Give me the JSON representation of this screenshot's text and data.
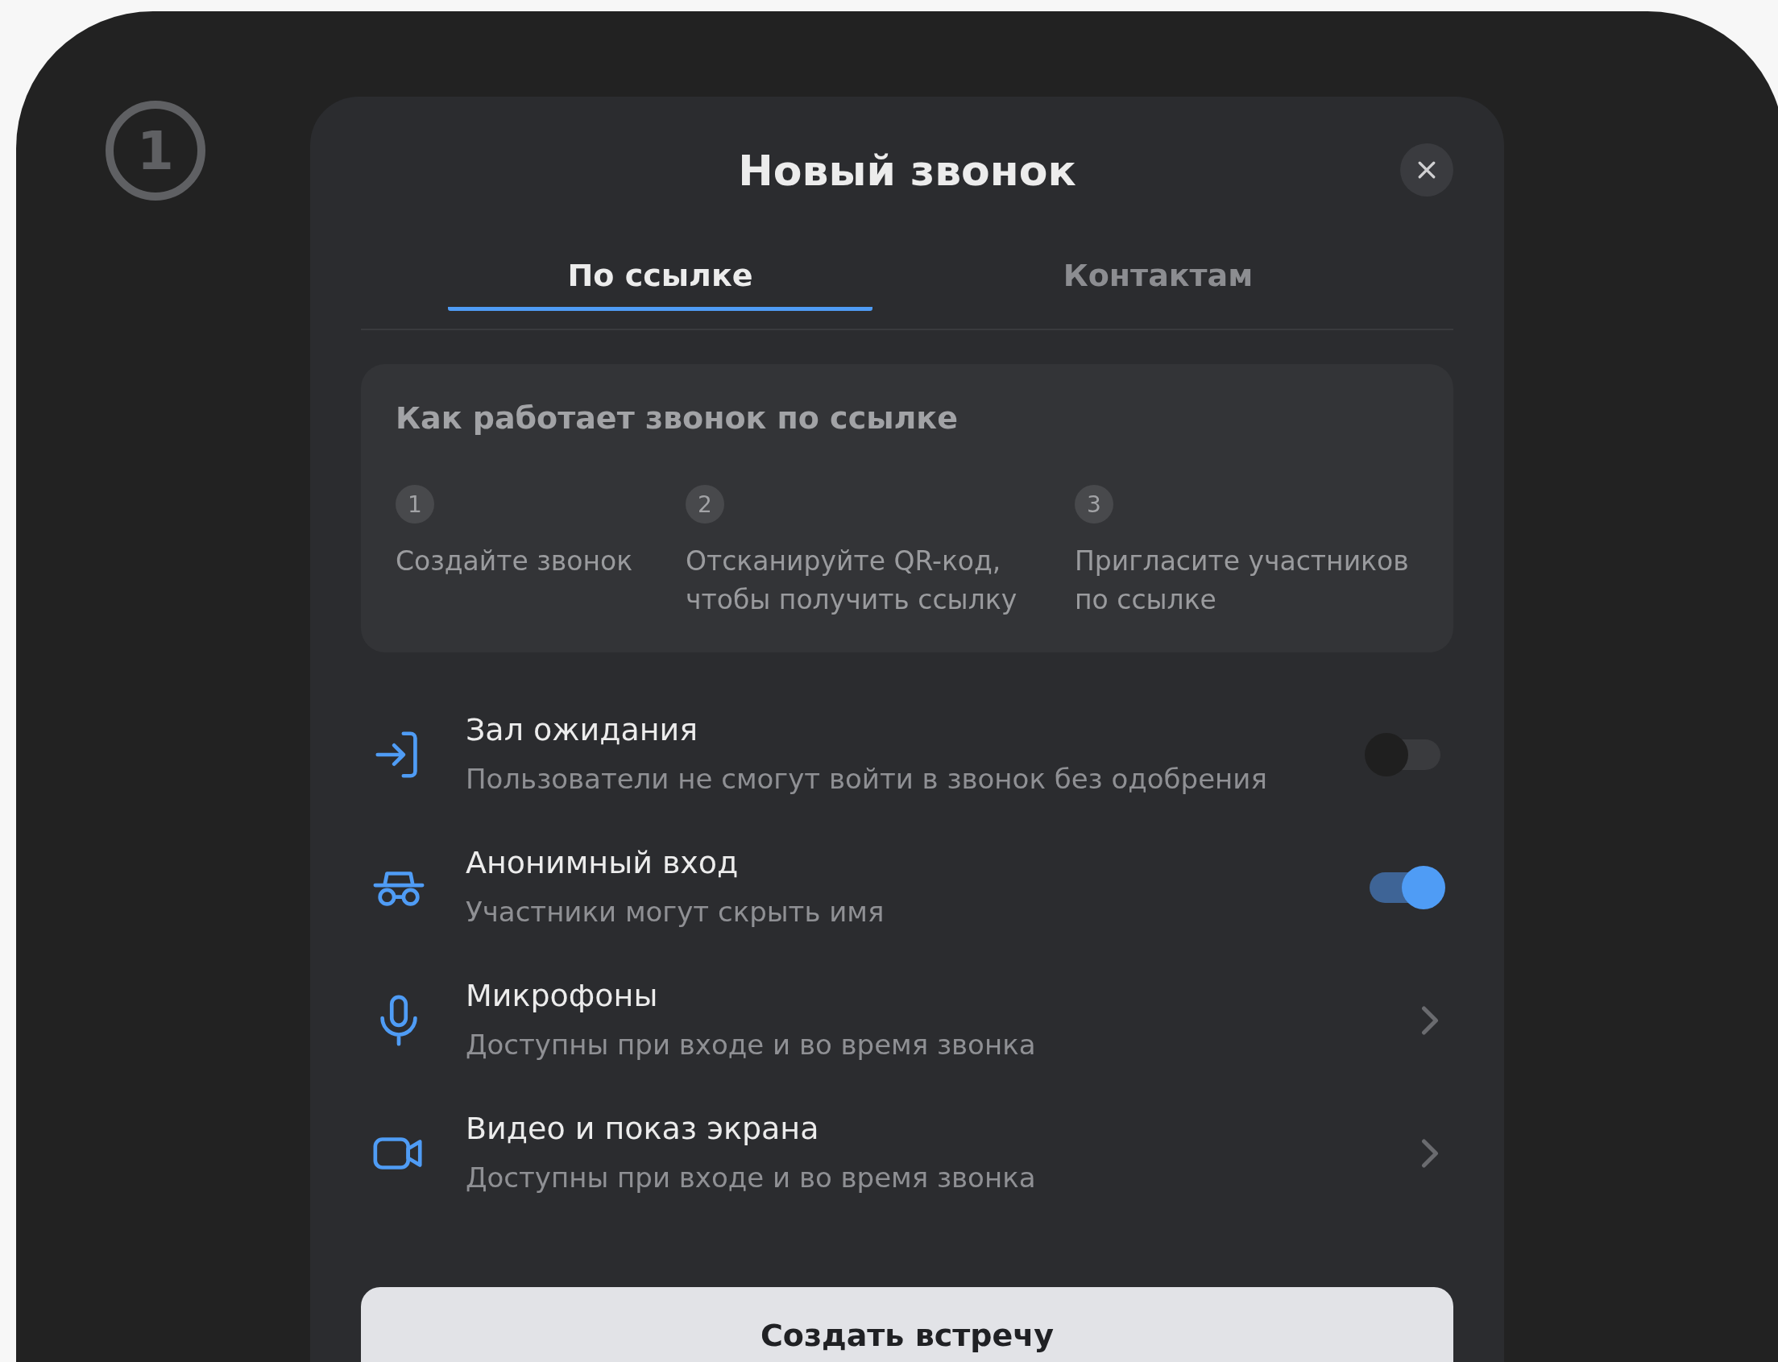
{
  "badge": "1",
  "dialog": {
    "title": "Новый звонок",
    "tabs": [
      {
        "label": "По ссылке",
        "selected": true
      },
      {
        "label": "Контактам",
        "selected": false
      }
    ],
    "info": {
      "heading": "Как работает звонок по ссылке",
      "steps": [
        {
          "number": "1",
          "text": "Создайте звонок"
        },
        {
          "number": "2",
          "text": "Отсканируйте QR-код, чтобы получить ссылку"
        },
        {
          "number": "3",
          "text": "Пригласите участников по ссылке"
        }
      ]
    },
    "options": [
      {
        "kind": "toggle",
        "title": "Зал ожидания",
        "subtitle": "Пользователи не смогут войти в звонок без одобрения",
        "on": false
      },
      {
        "kind": "toggle",
        "title": "Анонимный вход",
        "subtitle": "Участники могут скрыть имя",
        "on": true
      },
      {
        "kind": "link",
        "title": "Микрофоны",
        "subtitle": "Доступны при входе и во время звонка"
      },
      {
        "kind": "link",
        "title": "Видео и показ экрана",
        "subtitle": "Доступны при входе и во время звонка"
      }
    ],
    "primary_button": "Создать встречу"
  }
}
